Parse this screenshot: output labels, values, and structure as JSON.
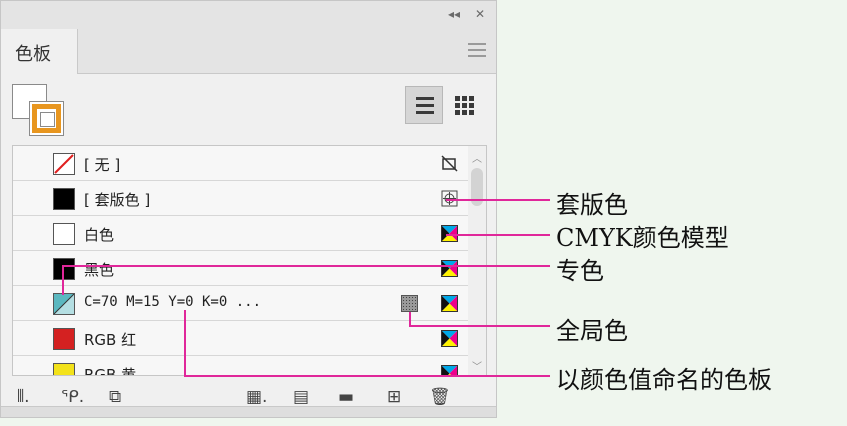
{
  "panel": {
    "titlebar": {
      "collapse_icon": "◂◂",
      "close_icon": "✕"
    },
    "tab_label": "色板",
    "swatch_rows": [
      {
        "name": "[ 无 ]",
        "chip": "none",
        "right_icon": "no-edit-icon"
      },
      {
        "name": "[ 套版色 ]",
        "chip": "#000000",
        "right_icon": "registration-icon"
      },
      {
        "name": "白色",
        "chip": "#ffffff",
        "right_icon": "cmyk-icon"
      },
      {
        "name": "黑色",
        "chip": "#000000",
        "right_icon": "cmyk-icon"
      },
      {
        "name": "C=70 M=15 Y=0 K=0 ...",
        "chip": "#5bb8c0",
        "right_icon": "cmyk-icon",
        "global": true
      },
      {
        "name": "RGB 红",
        "chip": "#d42121",
        "right_icon": "cmyk-icon"
      },
      {
        "name": "RGB 黄",
        "chip": "#f3e21a",
        "right_icon": "cmyk-icon"
      }
    ]
  },
  "callouts": [
    {
      "label": "套版色"
    },
    {
      "label": "CMYK颜色模型"
    },
    {
      "label": "专色"
    },
    {
      "label": "全局色"
    },
    {
      "label": "以颜色值命名的色板"
    }
  ],
  "colors": {
    "accent_orange": "#e8961f",
    "callout_magenta": "#e0279a",
    "background": "#eff6ee"
  }
}
